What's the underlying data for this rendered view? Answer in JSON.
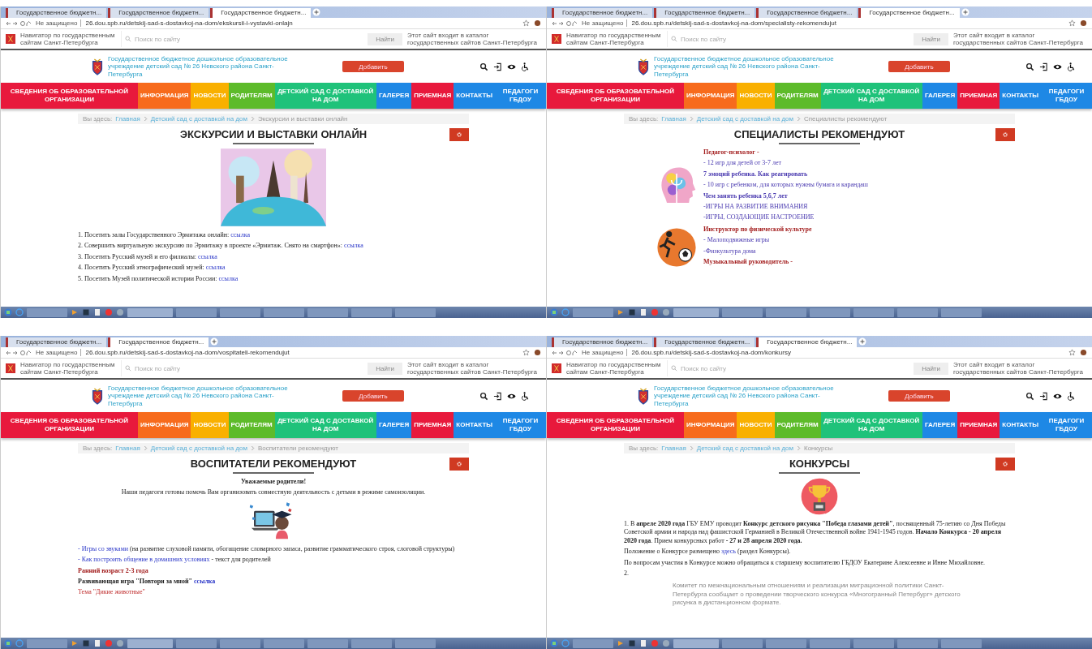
{
  "panels": [
    {
      "tabs": [
        {
          "label": "Государственное бюджетн...",
          "selected": false
        },
        {
          "label": "Государственное бюджетн...",
          "selected": false
        },
        {
          "label": "Государственное бюджетн...",
          "selected": true
        }
      ],
      "address": {
        "security": "Не защищено",
        "url": "26.dou.spb.ru/detskij-sad-s-dostavkoj-na-dom/ekskursii-i-vystavki-onlajn"
      },
      "gov_bar": {
        "left": "Навигатор по государственным сайтам Санкт-Петербурга",
        "search_placeholder": "Поиск по сайту",
        "search_button": "Найти",
        "right": "Этот сайт входит в каталог государственных сайтов Санкт-Петербурга"
      },
      "org_name": "Государственное бюджетное дошкольное образовательное учреждение детский сад № 26 Невского района Санкт-Петербурга",
      "add_button": "Добавить",
      "menu": [
        {
          "label": "СВЕДЕНИЯ ОБ ОБРАЗОВАТЕЛЬНОЙ ОРГАНИЗАЦИИ",
          "color": "#e8193c"
        },
        {
          "label": "ИНФОРМАЦИЯ",
          "color": "#f76b1c"
        },
        {
          "label": "НОВОСТИ",
          "color": "#f9b000"
        },
        {
          "label": "РОДИТЕЛЯМ",
          "color": "#5dbb2a"
        },
        {
          "label": "ДЕТСКИЙ САД С ДОСТАВКОЙ НА ДОМ",
          "color": "#1fc27a"
        },
        {
          "label": "ГАЛЕРЕЯ",
          "color": "#1e88e5"
        },
        {
          "label": "ПРИЕМНАЯ",
          "color": "#e8193c"
        },
        {
          "label": "КОНТАКТЫ",
          "color": "#1e88e5"
        },
        {
          "label": "ПЕДАГОГИ ГБДОУ",
          "color": "#1e88e5"
        }
      ],
      "breadcrumb": {
        "prefix": "Вы здесь:",
        "items": [
          "Главная",
          "Детский сад с доставкой на дом",
          "Экскурсии и выставки онлайн"
        ]
      },
      "title": "ЭКСКУРСИИ И ВЫСТАВКИ ОНЛАЙН",
      "blocks": [
        {
          "kind": "landmarks"
        },
        {
          "kind": "text",
          "parts": [
            {
              "kind": "text",
              "text": "1. Посетить залы Государственного Эрмитажа онлайн: "
            },
            {
              "kind": "link",
              "text": "ссылка"
            }
          ]
        },
        {
          "kind": "text",
          "parts": [
            {
              "kind": "text",
              "text": "2. Совершить виртуальную экскурсию по Эрмитажу в проекте «Эрмитаж. Снято на смартфон»: "
            },
            {
              "kind": "link",
              "text": "ссылка"
            }
          ]
        },
        {
          "kind": "text",
          "parts": [
            {
              "kind": "text",
              "text": "3. Посетить Русский музей и его филиалы: "
            },
            {
              "kind": "link",
              "text": "ссылка"
            }
          ]
        },
        {
          "kind": "text",
          "parts": [
            {
              "kind": "text",
              "text": "4. Посетить Русский этнографический музей: "
            },
            {
              "kind": "link",
              "text": "ссылка"
            }
          ]
        },
        {
          "kind": "text",
          "parts": [
            {
              "kind": "text",
              "text": "5. Посетить Музей политической истории России: "
            },
            {
              "kind": "link",
              "text": "ссылка"
            }
          ]
        }
      ]
    },
    {
      "tabs": [
        {
          "label": "Государственное бюджетн...",
          "selected": false
        },
        {
          "label": "Государственное бюджетн...",
          "selected": false
        },
        {
          "label": "Государственное бюджетн...",
          "selected": false
        },
        {
          "label": "Государственное бюджетн...",
          "selected": true
        }
      ],
      "address": {
        "security": "Не защищено",
        "url": "26.dou.spb.ru/detskij-sad-s-dostavkoj-na-dom/specialisty-rekomendujut"
      },
      "gov_bar": {
        "left": "Навигатор по государственным сайтам Санкт-Петербурга",
        "search_placeholder": "Поиск по сайту",
        "search_button": "Найти",
        "right": "Этот сайт входит в каталог государственных сайтов Санкт-Петербурга"
      },
      "org_name": "Государственное бюджетное дошкольное образовательное учреждение детский сад № 26 Невского района Санкт-Петербурга",
      "add_button": "Добавить",
      "menu": [
        {
          "label": "СВЕДЕНИЯ ОБ ОБРАЗОВАТЕЛЬНОЙ ОРГАНИЗАЦИИ",
          "color": "#e8193c"
        },
        {
          "label": "ИНФОРМАЦИЯ",
          "color": "#f76b1c"
        },
        {
          "label": "НОВОСТИ",
          "color": "#f9b000"
        },
        {
          "label": "РОДИТЕЛЯМ",
          "color": "#5dbb2a"
        },
        {
          "label": "ДЕТСКИЙ САД С ДОСТАВКОЙ НА ДОМ",
          "color": "#1fc27a"
        },
        {
          "label": "ГАЛЕРЕЯ",
          "color": "#1e88e5"
        },
        {
          "label": "ПРИЕМНАЯ",
          "color": "#e8193c"
        },
        {
          "label": "КОНТАКТЫ",
          "color": "#1e88e5"
        },
        {
          "label": "ПЕДАГОГИ ГБДОУ",
          "color": "#1e88e5"
        }
      ],
      "breadcrumb": {
        "prefix": "Вы здесь:",
        "items": [
          "Главная",
          "Детский сад с доставкой на дом",
          "Специалисты рекомендуют"
        ]
      },
      "title": "СПЕЦИАЛИСТЫ РЕКОМЕНДУЮТ",
      "blocks": [
        {
          "kind": "row",
          "figure": {
            "kind": "head"
          },
          "paras": [
            {
              "kind": "heading",
              "parts": [
                {
                  "kind": "text",
                  "text": "Педагог-психолог -"
                }
              ]
            },
            {
              "kind": "text",
              "parts": [
                {
                  "kind": "link",
                  "text": "- 12 игр для детей от 3-7 лет"
                }
              ]
            },
            {
              "kind": "strong",
              "parts": [
                {
                  "kind": "link",
                  "text": "7 эмоций ребенка. Как реагировать"
                }
              ]
            },
            {
              "kind": "text",
              "parts": [
                {
                  "kind": "link",
                  "text": "- 10 игр с ребенком, для которых нужны бумага и карандаш"
                }
              ]
            },
            {
              "kind": "strong",
              "parts": [
                {
                  "kind": "link",
                  "text": "Чем занять ребенка 5,6,7 лет"
                }
              ]
            },
            {
              "kind": "text",
              "parts": [
                {
                  "kind": "link",
                  "text": "-ИГРЫ НА РАЗВИТИЕ ВНИМАНИЯ"
                }
              ]
            },
            {
              "kind": "text",
              "parts": [
                {
                  "kind": "link",
                  "text": "-ИГРЫ, СОЗДАЮЩИЕ НАСТРОЕНИЕ"
                }
              ]
            }
          ]
        },
        {
          "kind": "row",
          "figure": {
            "kind": "sports"
          },
          "paras": [
            {
              "kind": "heading",
              "parts": [
                {
                  "kind": "text",
                  "text": "Инструктор по физической культуре"
                }
              ]
            },
            {
              "kind": "text",
              "parts": [
                {
                  "kind": "link",
                  "text": "- Малоподвижные игры"
                }
              ]
            },
            {
              "kind": "text",
              "parts": [
                {
                  "kind": "link",
                  "text": "-Физкультура дома"
                }
              ]
            },
            {
              "kind": "heading",
              "parts": [
                {
                  "kind": "text",
                  "text": "Музыкальный руководитель -"
                }
              ]
            }
          ]
        }
      ]
    },
    {
      "tabs": [
        {
          "label": "Государственное бюджетн...",
          "selected": false
        },
        {
          "label": "Государственное бюджетн...",
          "selected": true
        }
      ],
      "address": {
        "security": "Не защищено",
        "url": "26.dou.spb.ru/detskij-sad-s-dostavkoj-na-dom/vospitateli-rekomendujut"
      },
      "gov_bar": {
        "left": "Навигатор по государственным сайтам Санкт-Петербурга",
        "search_placeholder": "Поиск по сайту",
        "search_button": "Найти",
        "right": "Этот сайт входит в каталог государственных сайтов Санкт-Петербурга"
      },
      "org_name": "Государственное бюджетное дошкольное образовательное учреждение детский сад № 26 Невского района Санкт-Петербурга",
      "add_button": "Добавить",
      "menu": [
        {
          "label": "СВЕДЕНИЯ ОБ ОБРАЗОВАТЕЛЬНОЙ ОРГАНИЗАЦИИ",
          "color": "#e8193c"
        },
        {
          "label": "ИНФОРМАЦИЯ",
          "color": "#f76b1c"
        },
        {
          "label": "НОВОСТИ",
          "color": "#f9b000"
        },
        {
          "label": "РОДИТЕЛЯМ",
          "color": "#5dbb2a"
        },
        {
          "label": "ДЕТСКИЙ САД С ДОСТАВКОЙ НА ДОМ",
          "color": "#1fc27a"
        },
        {
          "label": "ГАЛЕРЕЯ",
          "color": "#1e88e5"
        },
        {
          "label": "ПРИЕМНАЯ",
          "color": "#e8193c"
        },
        {
          "label": "КОНТАКТЫ",
          "color": "#1e88e5"
        },
        {
          "label": "ПЕДАГОГИ ГБДОУ",
          "color": "#1e88e5"
        }
      ],
      "breadcrumb": {
        "prefix": "Вы здесь:",
        "items": [
          "Главная",
          "Детский сад с доставкой на дом",
          "Воспитатели рекомендуют"
        ]
      },
      "title": "ВОСПИТАТЕЛИ РЕКОМЕНДУЮТ",
      "blocks": [
        {
          "kind": "greeting",
          "parts": [
            {
              "kind": "text",
              "text": "Уважаемые родители!"
            }
          ]
        },
        {
          "kind": "intro",
          "parts": [
            {
              "kind": "text",
              "text": "Наши педагоги готовы помочь Вам организовать совместную деятельность с детьми в режиме самоизоляции."
            }
          ]
        },
        {
          "kind": "graduate"
        },
        {
          "kind": "text",
          "parts": [
            {
              "kind": "link",
              "text": "- Игры со звуками"
            },
            {
              "kind": "text",
              "text": " (на развитие слуховой памяти, обогащение словарного запаса, развитие грамматического строя, слоговой структуры)"
            }
          ]
        },
        {
          "kind": "text",
          "parts": [
            {
              "kind": "link",
              "text": "- Как построить общение в домашних условиях"
            },
            {
              "kind": "text",
              "text": " - текст для родителей"
            }
          ]
        },
        {
          "kind": "heading",
          "parts": [
            {
              "kind": "text",
              "text": "Ранний возраст 2-3 года"
            }
          ]
        },
        {
          "kind": "strong",
          "parts": [
            {
              "kind": "text",
              "text": "Развивающая игра \"Повтори за мной\" "
            },
            {
              "kind": "link",
              "text": "ссылка"
            }
          ]
        },
        {
          "kind": "topic",
          "parts": [
            {
              "kind": "text",
              "text": "Тема \"Дикие животные\""
            }
          ]
        }
      ]
    },
    {
      "tabs": [
        {
          "label": "Государственное бюджетн...",
          "selected": false
        },
        {
          "label": "Государственное бюджетн...",
          "selected": false
        },
        {
          "label": "Государственное бюджетн...",
          "selected": true
        }
      ],
      "address": {
        "security": "Не защищено",
        "url": "26.dou.spb.ru/detskij-sad-s-dostavkoj-na-dom/konkursy"
      },
      "gov_bar": {
        "left": "Навигатор по государственным сайтам Санкт-Петербурга",
        "search_placeholder": "Поиск по сайту",
        "search_button": "Найти",
        "right": "Этот сайт входит в каталог государственных сайтов Санкт-Петербурга"
      },
      "org_name": "Государственное бюджетное дошкольное образовательное учреждение детский сад № 26 Невского района Санкт-Петербурга",
      "add_button": "Добавить",
      "menu": [
        {
          "label": "СВЕДЕНИЯ ОБ ОБРАЗОВАТЕЛЬНОЙ ОРГАНИЗАЦИИ",
          "color": "#e8193c"
        },
        {
          "label": "ИНФОРМАЦИЯ",
          "color": "#f76b1c"
        },
        {
          "label": "НОВОСТИ",
          "color": "#f9b000"
        },
        {
          "label": "РОДИТЕЛЯМ",
          "color": "#5dbb2a"
        },
        {
          "label": "ДЕТСКИЙ САД С ДОСТАВКОЙ НА ДОМ",
          "color": "#1fc27a"
        },
        {
          "label": "ГАЛЕРЕЯ",
          "color": "#1e88e5"
        },
        {
          "label": "ПРИЕМНАЯ",
          "color": "#e8193c"
        },
        {
          "label": "КОНТАКТЫ",
          "color": "#1e88e5"
        },
        {
          "label": "ПЕДАГОГИ ГБДОУ",
          "color": "#1e88e5"
        }
      ],
      "breadcrumb": {
        "prefix": "Вы здесь:",
        "items": [
          "Главная",
          "Детский сад с доставкой на дом",
          "Конкурсы"
        ]
      },
      "title": "КОНКУРСЫ",
      "blocks": [
        {
          "kind": "trophy"
        },
        {
          "kind": "text",
          "parts": [
            {
              "kind": "text",
              "text": "1. В **апреле 2020 года** ГБУ ЕМУ проводит **Конкурс детского рисунка \"Победа глазами детей\"**, посвященный 75-летию со Дня Победы Советской армии и народа над фашистской Германией в Великой Отечественной войне 1941-1945 годов. **Начало Конкурса - 20 апреля 2020 года**. Прием конкурсных работ **- 27 и 28 апреля 2020 года.**"
            }
          ]
        },
        {
          "kind": "text",
          "parts": [
            {
              "kind": "text",
              "text": "Положение о Конкурсе размещено "
            },
            {
              "kind": "link",
              "text": "здесь"
            },
            {
              "kind": "text",
              "text": " (раздел Конкурсы)."
            }
          ]
        },
        {
          "kind": "text",
          "parts": [
            {
              "kind": "text",
              "text": "По вопросам участия в Конкурсе можно обращаться к старшему воспитателю ГБДОУ Екатерине Алексеевне и Инне Михайловне."
            }
          ]
        },
        {
          "kind": "text",
          "parts": [
            {
              "kind": "text",
              "text": "2."
            }
          ]
        },
        {
          "kind": "note",
          "parts": [
            {
              "kind": "text",
              "text": "Комитет по межнациональным отношениям и реализации миграционной политики Санкт-Петербурга сообщает о проведении творческого конкурса «Многогранный Петербург» детского рисунка в дистанционном формате."
            }
          ]
        }
      ]
    }
  ]
}
